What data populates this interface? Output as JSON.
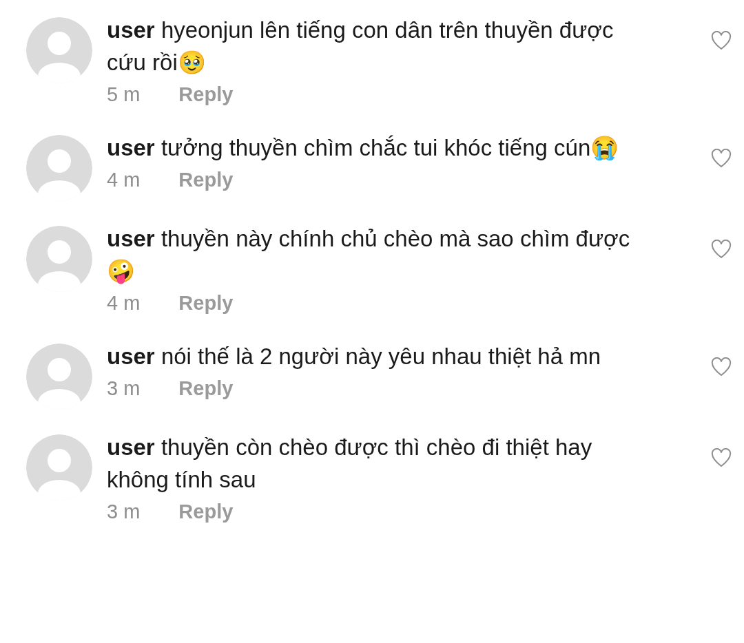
{
  "comments": [
    {
      "text": "**user** hyeonjun lên tiếng con dân trên thuyền được cứu rồi🥹",
      "time": "5 m",
      "reply": "Reply"
    },
    {
      "text": "**user** tưởng thuyền chìm chắc tui khóc tiếng cún😭",
      "time": "4 m",
      "reply": "Reply"
    },
    {
      "text": "**user** thuyền này chính chủ chèo mà sao chìm được🤪",
      "time": "4 m",
      "reply": "Reply"
    },
    {
      "text": "**user** nói thế là 2 người này yêu nhau thiệt hả mn",
      "time": "3 m",
      "reply": "Reply"
    },
    {
      "text": "**user** thuyền còn chèo được thì chèo đi thiệt hay không tính sau",
      "time": "3 m",
      "reply": "Reply"
    }
  ]
}
